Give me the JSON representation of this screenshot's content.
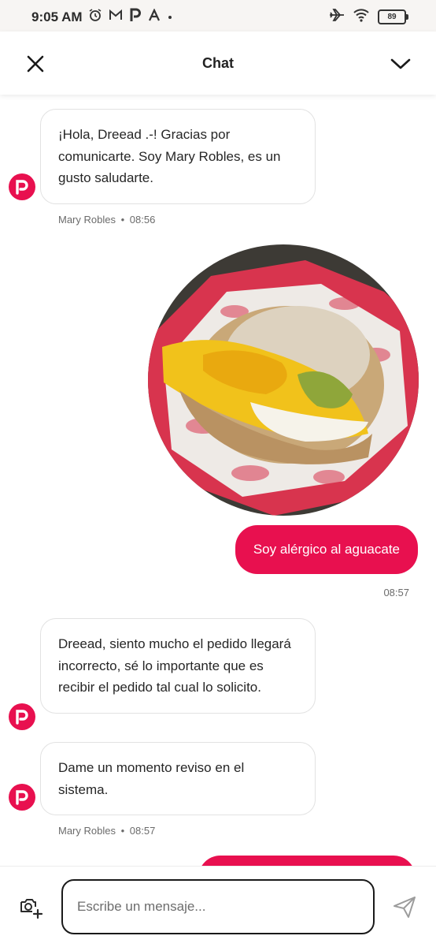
{
  "status_bar": {
    "time": "9:05 AM",
    "battery": "89",
    "icons_left": [
      "alarm-icon",
      "gmail-icon",
      "parking-app-icon",
      "arrow-app-icon",
      "dot-icon"
    ],
    "icons_right": [
      "airplane-icon",
      "wifi-icon",
      "battery-icon"
    ]
  },
  "header": {
    "title": "Chat",
    "left_icon": "close-icon",
    "right_icon": "chevron-down-icon"
  },
  "messages": [
    {
      "direction": "incoming",
      "text": "¡Hola, Dreead .-! Gracias por comunicarte. Soy Mary Robles, es un gusto saludarte.",
      "sender": "Mary Robles",
      "time": "08:56"
    },
    {
      "direction": "outgoing",
      "type": "image",
      "image": "photo of a half-eaten egg sandwich on red patterned paper"
    },
    {
      "direction": "outgoing",
      "text": "Soy alérgico al aguacate",
      "time": "08:57"
    },
    {
      "direction": "incoming",
      "text": "Dreead, siento mucho el pedido llegará incorrecto, sé lo importante que es recibir el pedido tal cual lo solicito."
    },
    {
      "direction": "incoming",
      "text": "Dame un momento reviso en el sistema.",
      "sender": "Mary Robles",
      "time": "08:57"
    }
  ],
  "input_bar": {
    "placeholder": "Escribe un mensaje...",
    "left_icon": "camera-add-icon",
    "right_icon": "send-icon"
  },
  "colors": {
    "brand": "#e8104f",
    "bubble_border": "#e2e2e2",
    "status_bg": "#f7f5f3"
  }
}
